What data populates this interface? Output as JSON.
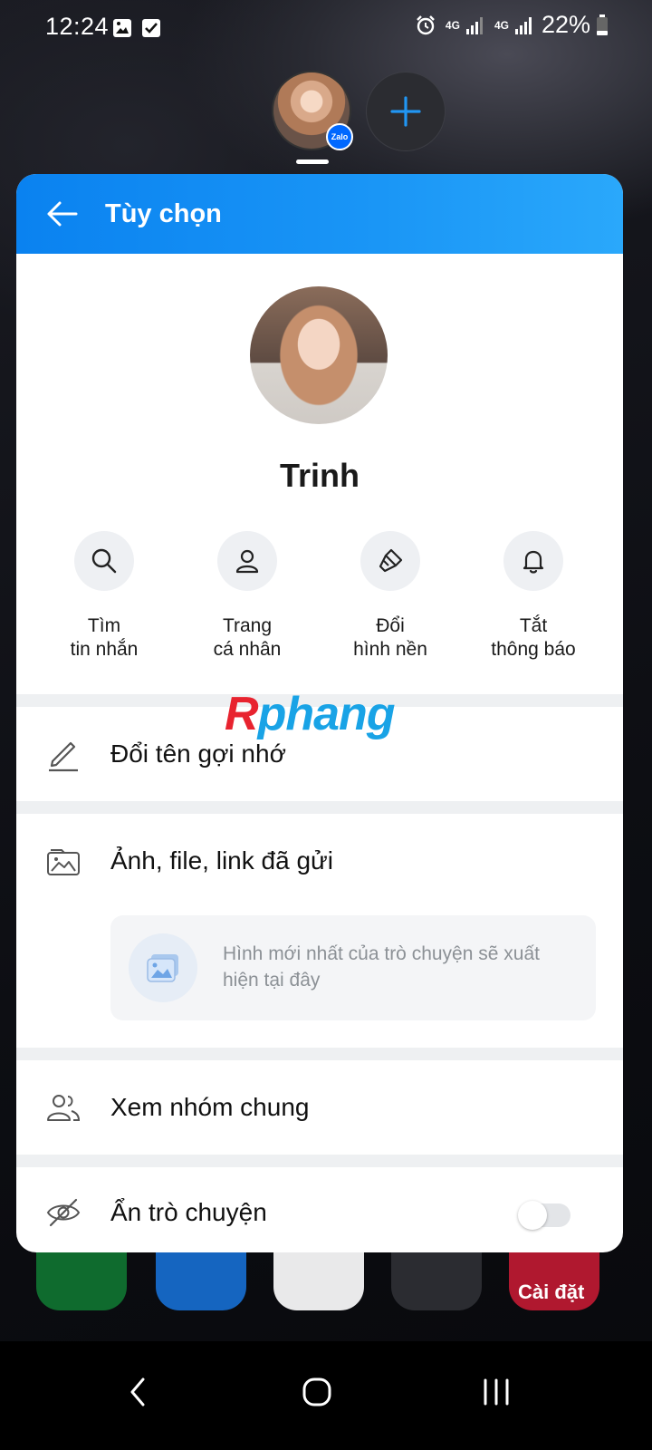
{
  "status_bar": {
    "time": "12:24",
    "network_1": "4G",
    "network_2": "4G",
    "battery": "22%"
  },
  "bubble": {
    "badge": "Zalo"
  },
  "header": {
    "title": "Tùy chọn"
  },
  "profile": {
    "name": "Trinh"
  },
  "actions": [
    {
      "icon": "search-icon",
      "label": "Tìm\ntin nhắn"
    },
    {
      "icon": "person-icon",
      "label": "Trang\ncá nhân"
    },
    {
      "icon": "paintbrush-icon",
      "label": "Đổi\nhình nền"
    },
    {
      "icon": "bell-icon",
      "label": "Tắt\nthông báo"
    }
  ],
  "watermark": {
    "first": "R",
    "rest": "phang"
  },
  "menu": {
    "rename": "Đổi tên gợi nhớ",
    "media": "Ảnh, file, link đã gửi",
    "media_placeholder": "Hình mới nhất của trò chuyện sẽ xuất hiện tại đây",
    "groups": "Xem nhóm chung",
    "hide": "Ẩn trò chuyện"
  },
  "toggles": {
    "hide_chat": false
  },
  "dock": {
    "settings_label": "Cài đặt"
  },
  "colors": {
    "header_start": "#0a82f0",
    "header_end": "#2aa8fb",
    "accent": "#1e90ff"
  }
}
